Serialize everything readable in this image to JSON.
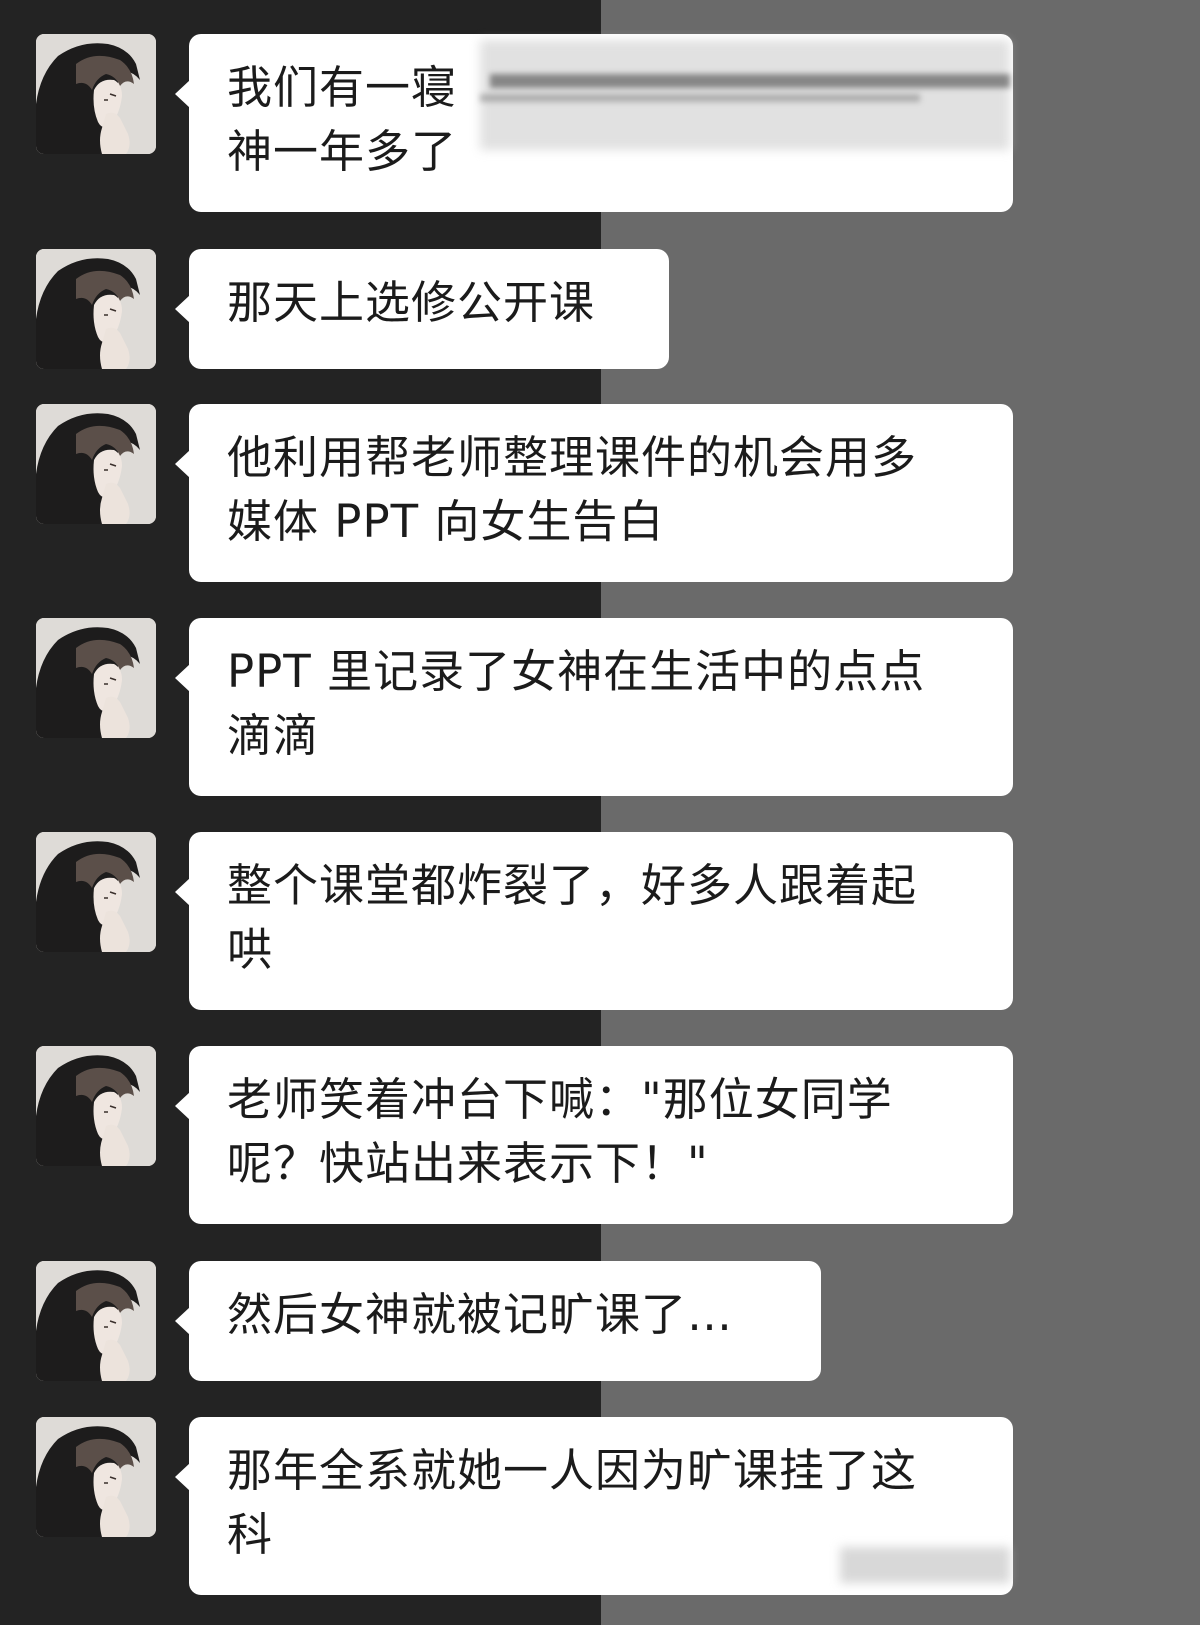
{
  "colors": {
    "left_background": "#232323",
    "right_background": "#6a6a6a",
    "bubble": "#ffffff",
    "text": "#1b1b1b"
  },
  "sender": {
    "avatar_icon": "anime-boy-avatar-icon"
  },
  "messages": [
    {
      "text": "我们有一寝\n神一年多了",
      "redacted": true
    },
    {
      "text": "那天上选修公开课"
    },
    {
      "text": "他利用帮老师整理课件的机会用多\n媒体 PPT 向女生告白"
    },
    {
      "text": "PPT 里记录了女神在生活中的点点\n滴滴"
    },
    {
      "text": "整个课堂都炸裂了，好多人跟着起\n哄"
    },
    {
      "text": "老师笑着冲台下喊：\"那位女同学\n呢？快站出来表示下！\""
    },
    {
      "text": "然后女神就被记旷课了…"
    },
    {
      "text": "那年全系就她一人因为旷课挂了这\n科"
    }
  ]
}
